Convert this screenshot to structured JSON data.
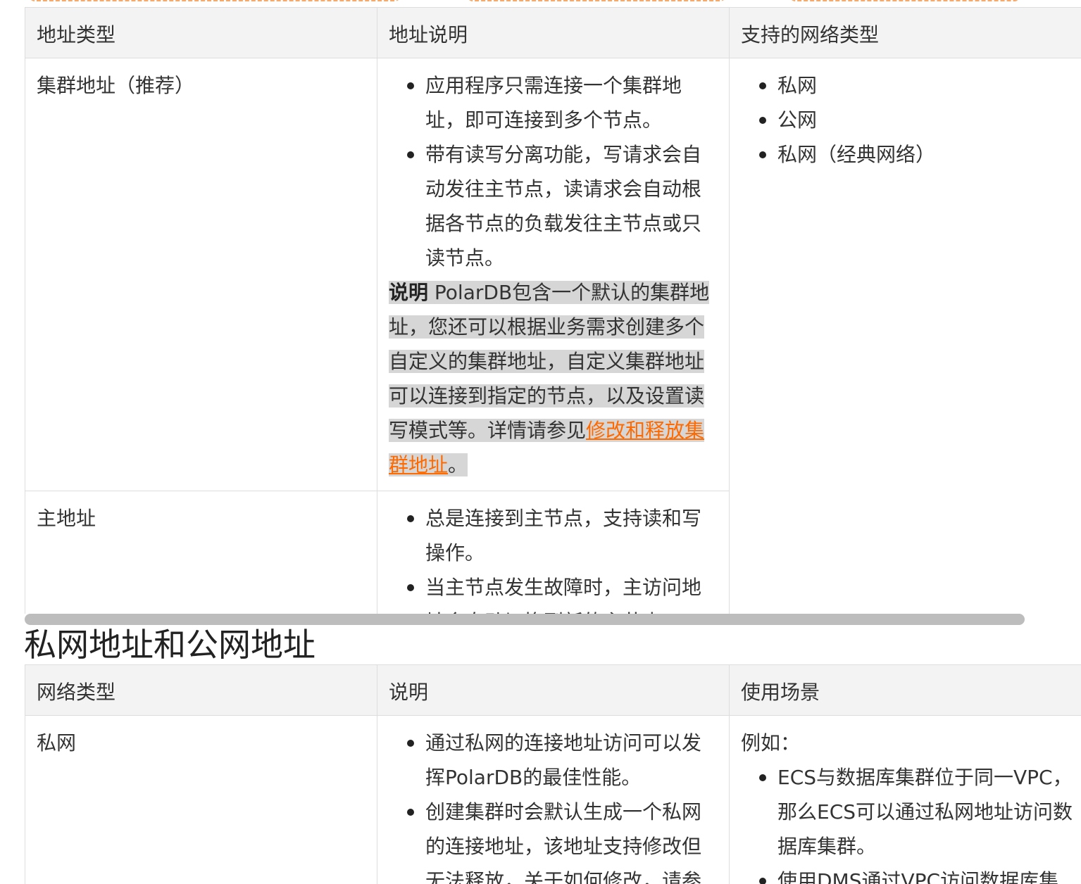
{
  "table1": {
    "headers": [
      "地址类型",
      "地址说明",
      "支持的网络类型"
    ],
    "rows": [
      {
        "type": "集群地址（推荐）",
        "desc_items": [
          "应用程序只需连接一个集群地址，即可连接到多个节点。",
          "带有读写分离功能，写请求会自动发往主节点，读请求会自动根据各节点的负载发往主节点或只读节点。"
        ],
        "note_label": "说明",
        "note_text": " PolarDB包含一个默认的集群地址，您还可以根据业务需求创建多个自定义的集群地址，自定义集群地址可以连接到指定的节点，以及设置读写模式等。详情请参见",
        "note_link": "修改和释放集群地址",
        "note_end": "。",
        "networks": [
          "私网",
          "公网",
          "私网（经典网络）"
        ]
      },
      {
        "type": "主地址",
        "desc_items": [
          "总是连接到主节点，支持读和写操作。",
          "当主节点发生故障时，主访问地址会自动切换到新的主节点。"
        ]
      }
    ]
  },
  "section_title": "私网地址和公网地址",
  "table2": {
    "headers": [
      "网络类型",
      "说明",
      "使用场景"
    ],
    "rows": [
      {
        "type": "私网",
        "desc_items": [
          "通过私网的连接地址访问可以发挥PolarDB的最佳性能。",
          "创建集群时会默认生成一个私网的连接地址，该地址支持修改但无法释放，关于如何修改，请参"
        ],
        "usage_intro": "例如：",
        "usage_items": [
          "ECS与数据库集群位于同一VPC，那么ECS可以通过私网地址访问数据库集群。",
          "使用DMS通过VPC访问数据库集"
        ]
      }
    ]
  }
}
